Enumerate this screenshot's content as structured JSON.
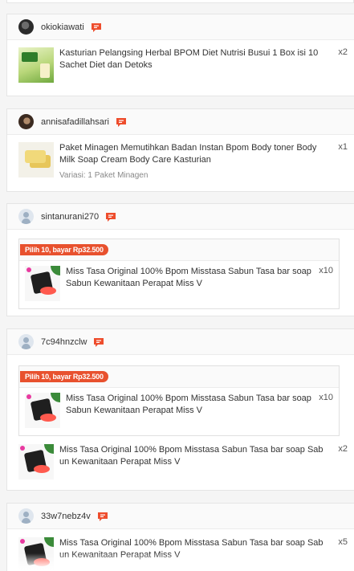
{
  "orders": [
    {
      "username": "okiokiawati",
      "items": [
        {
          "title": "Kasturian Pelangsing Herbal BPOM Diet Nutrisi Busui 1 Box isi 10 Sachet Diet dan Detoks",
          "qty": "x2",
          "thumb": "kasturian-product-image"
        }
      ]
    },
    {
      "username": "annisafadillahsari",
      "items": [
        {
          "title": "Paket Minagen Memutihkan Badan Instan Bpom Body toner Body Milk Soap Cream Body Care Kasturian",
          "qty": "x1",
          "variation": "Variasi: 1 Paket Minagen",
          "thumb": "minagen-product-image"
        }
      ]
    },
    {
      "username": "sintanurani270",
      "promo": {
        "badge": "Pilih 10, bayar Rp32.500",
        "items": [
          {
            "title": "Miss Tasa Original 100% Bpom Misstasa Sabun Tasa bar soap Sabun Kewanitaan Perapat Miss V",
            "qty": "x10",
            "thumb": "misstasa-product-image"
          }
        ]
      }
    },
    {
      "username": "7c94hnzclw",
      "promo": {
        "badge": "Pilih 10, bayar Rp32.500",
        "items": [
          {
            "title": "Miss Tasa Original 100% Bpom Misstasa Sabun Tasa bar soap Sabun Kewanitaan Perapat Miss V",
            "qty": "x10",
            "thumb": "misstasa-product-image"
          }
        ]
      },
      "items": [
        {
          "title": "Miss Tasa Original 100% Bpom Misstasa Sabun Tasa bar soap Sab un Kewanitaan Perapat Miss V",
          "qty": "x2",
          "thumb": "misstasa-product-image"
        }
      ]
    },
    {
      "username": "33w7nebz4v",
      "items": [
        {
          "title": "Miss Tasa Original 100% Bpom Misstasa Sabun Tasa bar soap Sab un Kewanitaan Perapat Miss V",
          "qty": "x5",
          "thumb": "misstasa-product-image"
        }
      ]
    }
  ],
  "icons": {
    "chat": "chat-bubble-icon",
    "avatar_default": "default-avatar-icon"
  },
  "colors": {
    "accent": "#ee4d2d",
    "promo_badge": "#e8512e"
  }
}
